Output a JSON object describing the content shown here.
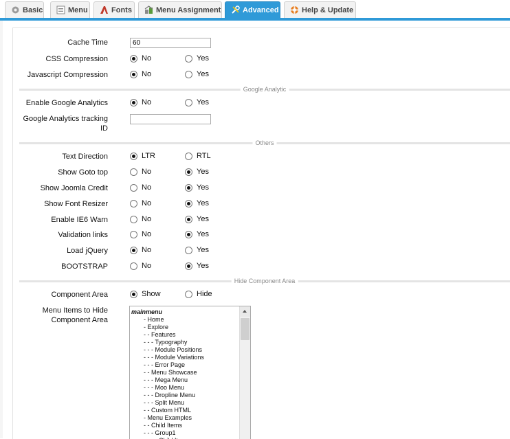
{
  "tabs": [
    {
      "label": "Basic",
      "icon": "gear-icon",
      "active": false
    },
    {
      "label": "Menu",
      "icon": "menu-icon",
      "active": false
    },
    {
      "label": "Fonts",
      "icon": "fonts-icon",
      "active": false
    },
    {
      "label": "Menu Assignment",
      "icon": "menu-assignment-icon",
      "active": false
    },
    {
      "label": "Advanced",
      "icon": "tools-icon",
      "active": true
    },
    {
      "label": "Help & Update",
      "icon": "lifebuoy-icon",
      "active": false
    }
  ],
  "colors": {
    "accent": "#2f9ad8"
  },
  "fields": {
    "cache_time": {
      "label": "Cache Time",
      "value": "60"
    },
    "css_compression": {
      "label": "CSS Compression",
      "options": [
        "No",
        "Yes"
      ],
      "selected": "No"
    },
    "js_compression": {
      "label": "Javascript Compression",
      "options": [
        "No",
        "Yes"
      ],
      "selected": "No"
    },
    "enable_ga": {
      "label": "Enable Google Analytics",
      "options": [
        "No",
        "Yes"
      ],
      "selected": "No"
    },
    "ga_tracking_id": {
      "label": "Google Analytics tracking ID",
      "value": ""
    },
    "text_direction": {
      "label": "Text Direction",
      "options": [
        "LTR",
        "RTL"
      ],
      "selected": "LTR"
    },
    "show_goto_top": {
      "label": "Show Goto top",
      "options": [
        "No",
        "Yes"
      ],
      "selected": "Yes"
    },
    "show_joomla_credit": {
      "label": "Show Joomla Credit",
      "options": [
        "No",
        "Yes"
      ],
      "selected": "Yes"
    },
    "show_font_resizer": {
      "label": "Show Font Resizer",
      "options": [
        "No",
        "Yes"
      ],
      "selected": "Yes"
    },
    "enable_ie6_warn": {
      "label": "Enable IE6 Warn",
      "options": [
        "No",
        "Yes"
      ],
      "selected": "Yes"
    },
    "validation_links": {
      "label": "Validation links",
      "options": [
        "No",
        "Yes"
      ],
      "selected": "Yes"
    },
    "load_jquery": {
      "label": "Load jQuery",
      "options": [
        "No",
        "Yes"
      ],
      "selected": "No"
    },
    "bootstrap": {
      "label": "BOOTSTRAP",
      "options": [
        "No",
        "Yes"
      ],
      "selected": "Yes"
    },
    "component_area": {
      "label": "Component Area",
      "options": [
        "Show",
        "Hide"
      ],
      "selected": "Show"
    },
    "menu_items_hide": {
      "label": "Menu Items to Hide Component Area"
    }
  },
  "sections": {
    "google_analytic": "Google Analytic",
    "others": "Others",
    "hide_component_area": "Hide Component Area"
  },
  "menu_items": [
    {
      "text": "mainmenu",
      "group": true
    },
    {
      "text": "- Home"
    },
    {
      "text": "- Explore"
    },
    {
      "text": "- - Features"
    },
    {
      "text": "- - - Typography"
    },
    {
      "text": "- - - Module Positions"
    },
    {
      "text": "- - - Module Variations"
    },
    {
      "text": "- - - Error Page"
    },
    {
      "text": "- - Menu Showcase"
    },
    {
      "text": "- - - Mega Menu"
    },
    {
      "text": "- - - Moo Menu"
    },
    {
      "text": "- - - Dropline Menu"
    },
    {
      "text": "- - - Split Menu"
    },
    {
      "text": "- - Custom HTML"
    },
    {
      "text": "- Menu Examples"
    },
    {
      "text": "- - Child Items"
    },
    {
      "text": "- - - Group1"
    },
    {
      "text": "- - - - Child Item"
    }
  ]
}
